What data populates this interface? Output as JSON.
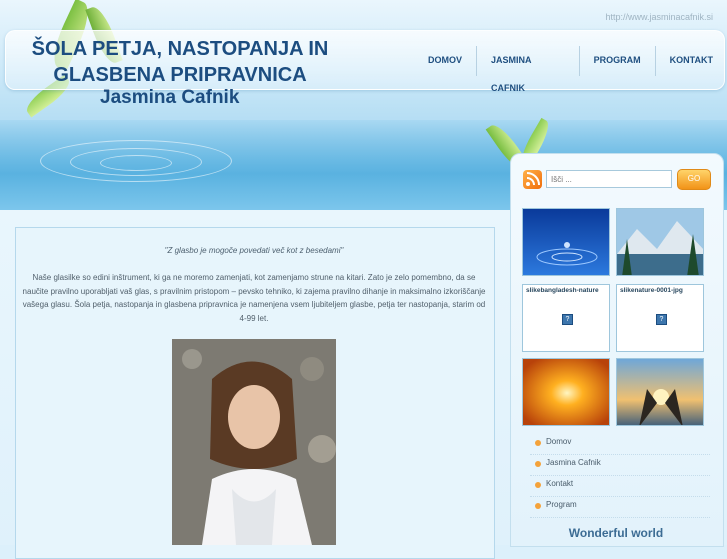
{
  "header": {
    "url": "http://www.jasminacafnik.si",
    "title_line1": "ŠOLA PETJA, NASTOPANJA IN",
    "title_line2": "GLASBENA PRIPRAVNICA",
    "subtitle": "Jasmina Cafnik"
  },
  "nav": [
    {
      "label": "DOMOV"
    },
    {
      "label": "JASMINA CAFNIK"
    },
    {
      "label": "PROGRAM"
    },
    {
      "label": "KONTAKT"
    }
  ],
  "main": {
    "quote": "\"Z glasbo je mogoče povedati več kot z besedami\"",
    "paragraph": "Naše glasilke so edini inštrument, ki ga ne moremo zamenjati, kot zamenjamo strune na kitari. Zato je zelo pomembno, da se naučite pravilno uporabljati vaš glas, s pravilnim pristopom – pevsko tehniko, ki zajema pravilno dihanje in maksimalno izkoriščanje vašega glasu. Šola petja, nastopanja in glasbena pripravnica je namenjena vsem ljubiteljem glasbe, petja ter nastopanja, starim od 4-99 let."
  },
  "sidebar": {
    "search_placeholder": "Išči ...",
    "go_label": "GO",
    "gallery_labels": [
      "slikebangladesh-nature",
      "slikenature-0001-jpg"
    ],
    "broken_icon": "?",
    "links": [
      {
        "label": "Domov"
      },
      {
        "label": "Jasmina Cafnik"
      },
      {
        "label": "Kontakt"
      },
      {
        "label": "Program"
      }
    ],
    "section_title": "Wonderful world"
  },
  "colors": {
    "title": "#1c4d80",
    "accent": "#f4a23a",
    "sky": "#a9d8f1"
  }
}
